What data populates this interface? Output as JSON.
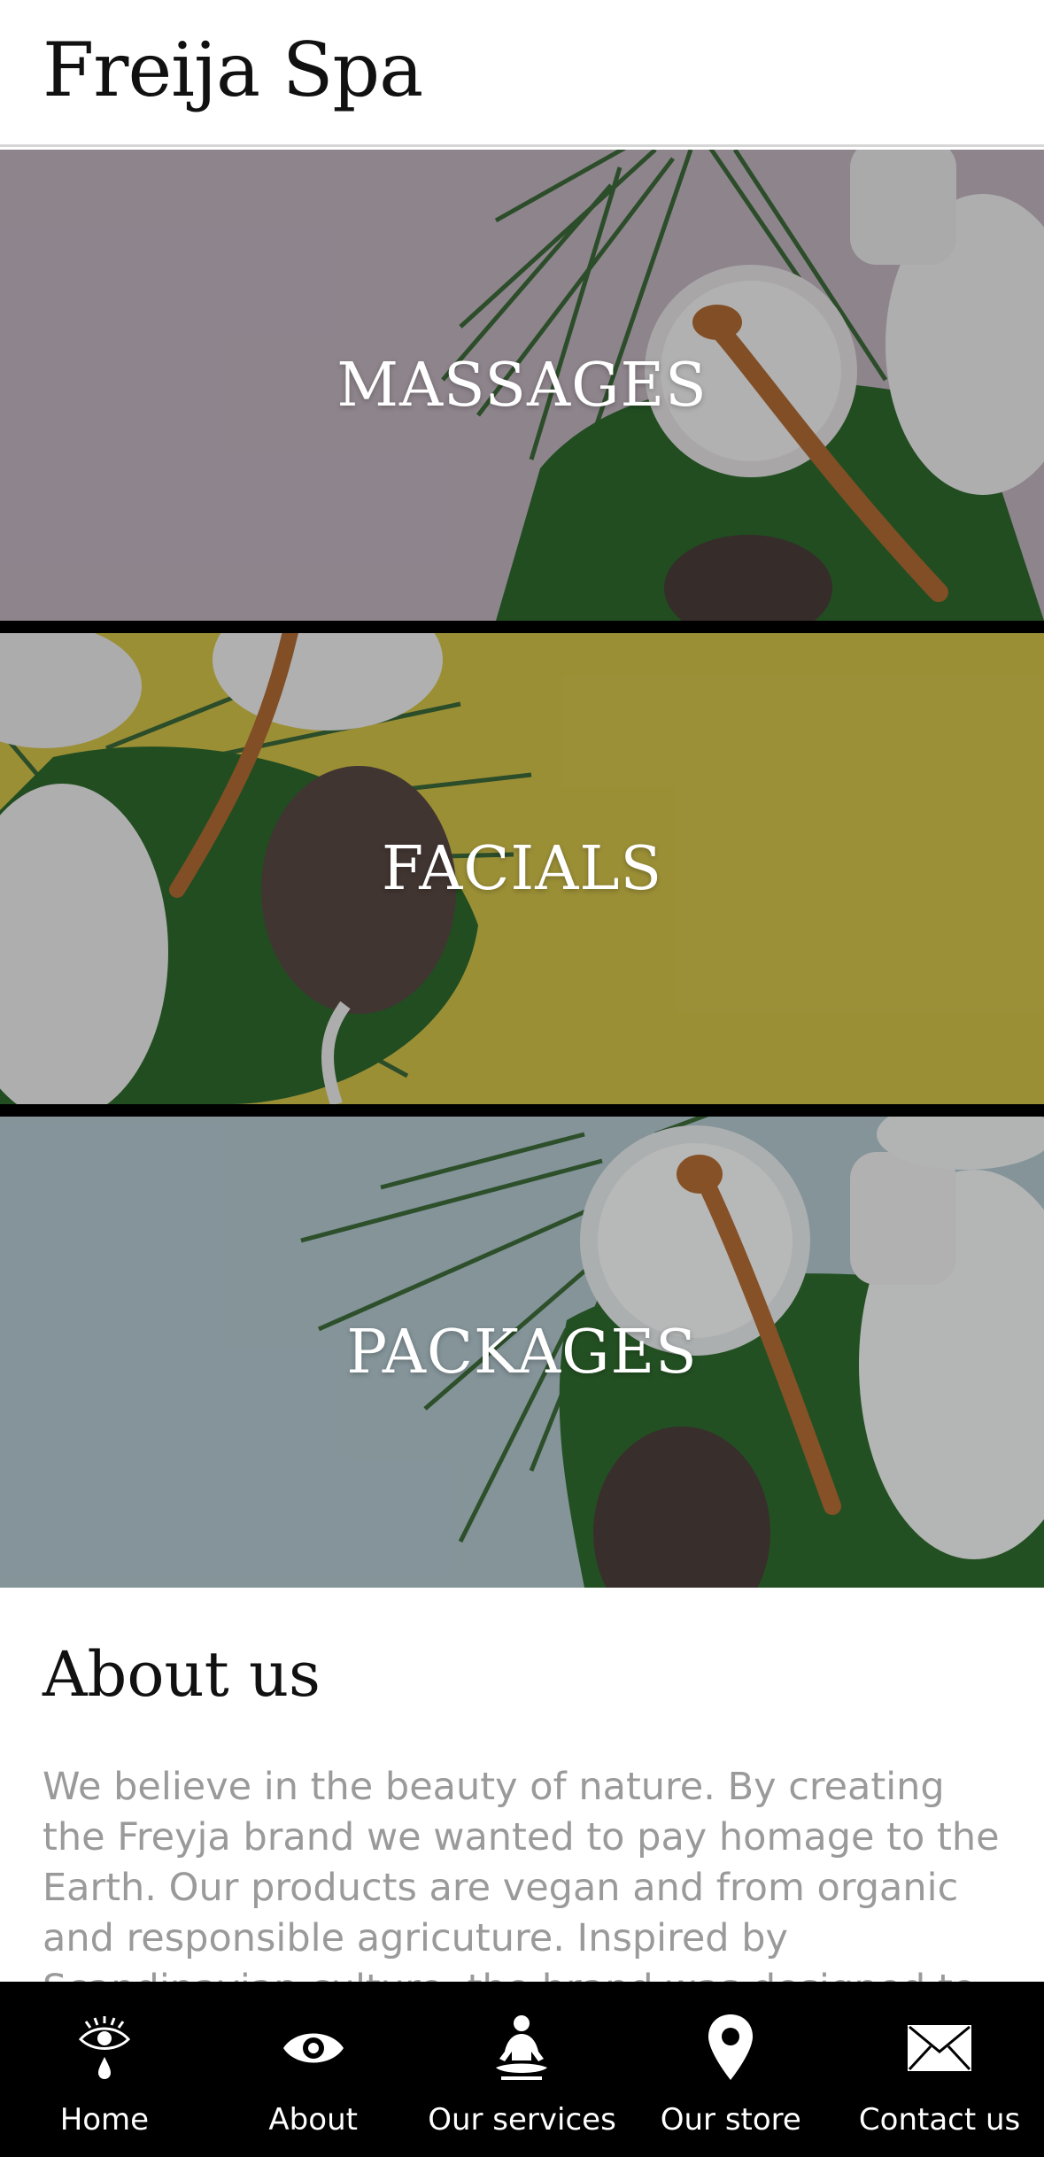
{
  "header": {
    "title": "Freija Spa"
  },
  "tiles": [
    {
      "label": "MASSAGES",
      "bg_color": "#8a7e88"
    },
    {
      "label": "FACIALS",
      "bg_color": "#9a913f"
    },
    {
      "label": "PACKAGES",
      "bg_color": "#7f9298"
    }
  ],
  "about": {
    "heading": "About us",
    "body": "We believe in the beauty of nature. By creating the Freyja brand we wanted to pay homage to the Earth. Our products are vegan and from organic and responsible agricuture. Inspired by Scandinavian culture, the brand was designed to enjoy nature and its benefits."
  },
  "nav": {
    "items": [
      {
        "label": "Home",
        "icon": "eye-tear-icon"
      },
      {
        "label": "About",
        "icon": "eye-icon"
      },
      {
        "label": "Our services",
        "icon": "meditation-icon"
      },
      {
        "label": "Our store",
        "icon": "map-pin-icon"
      },
      {
        "label": "Contact us",
        "icon": "envelope-icon"
      }
    ]
  },
  "colors": {
    "nav_background": "#000000",
    "body_text": "#9a9a9a",
    "title_text": "#111111"
  }
}
